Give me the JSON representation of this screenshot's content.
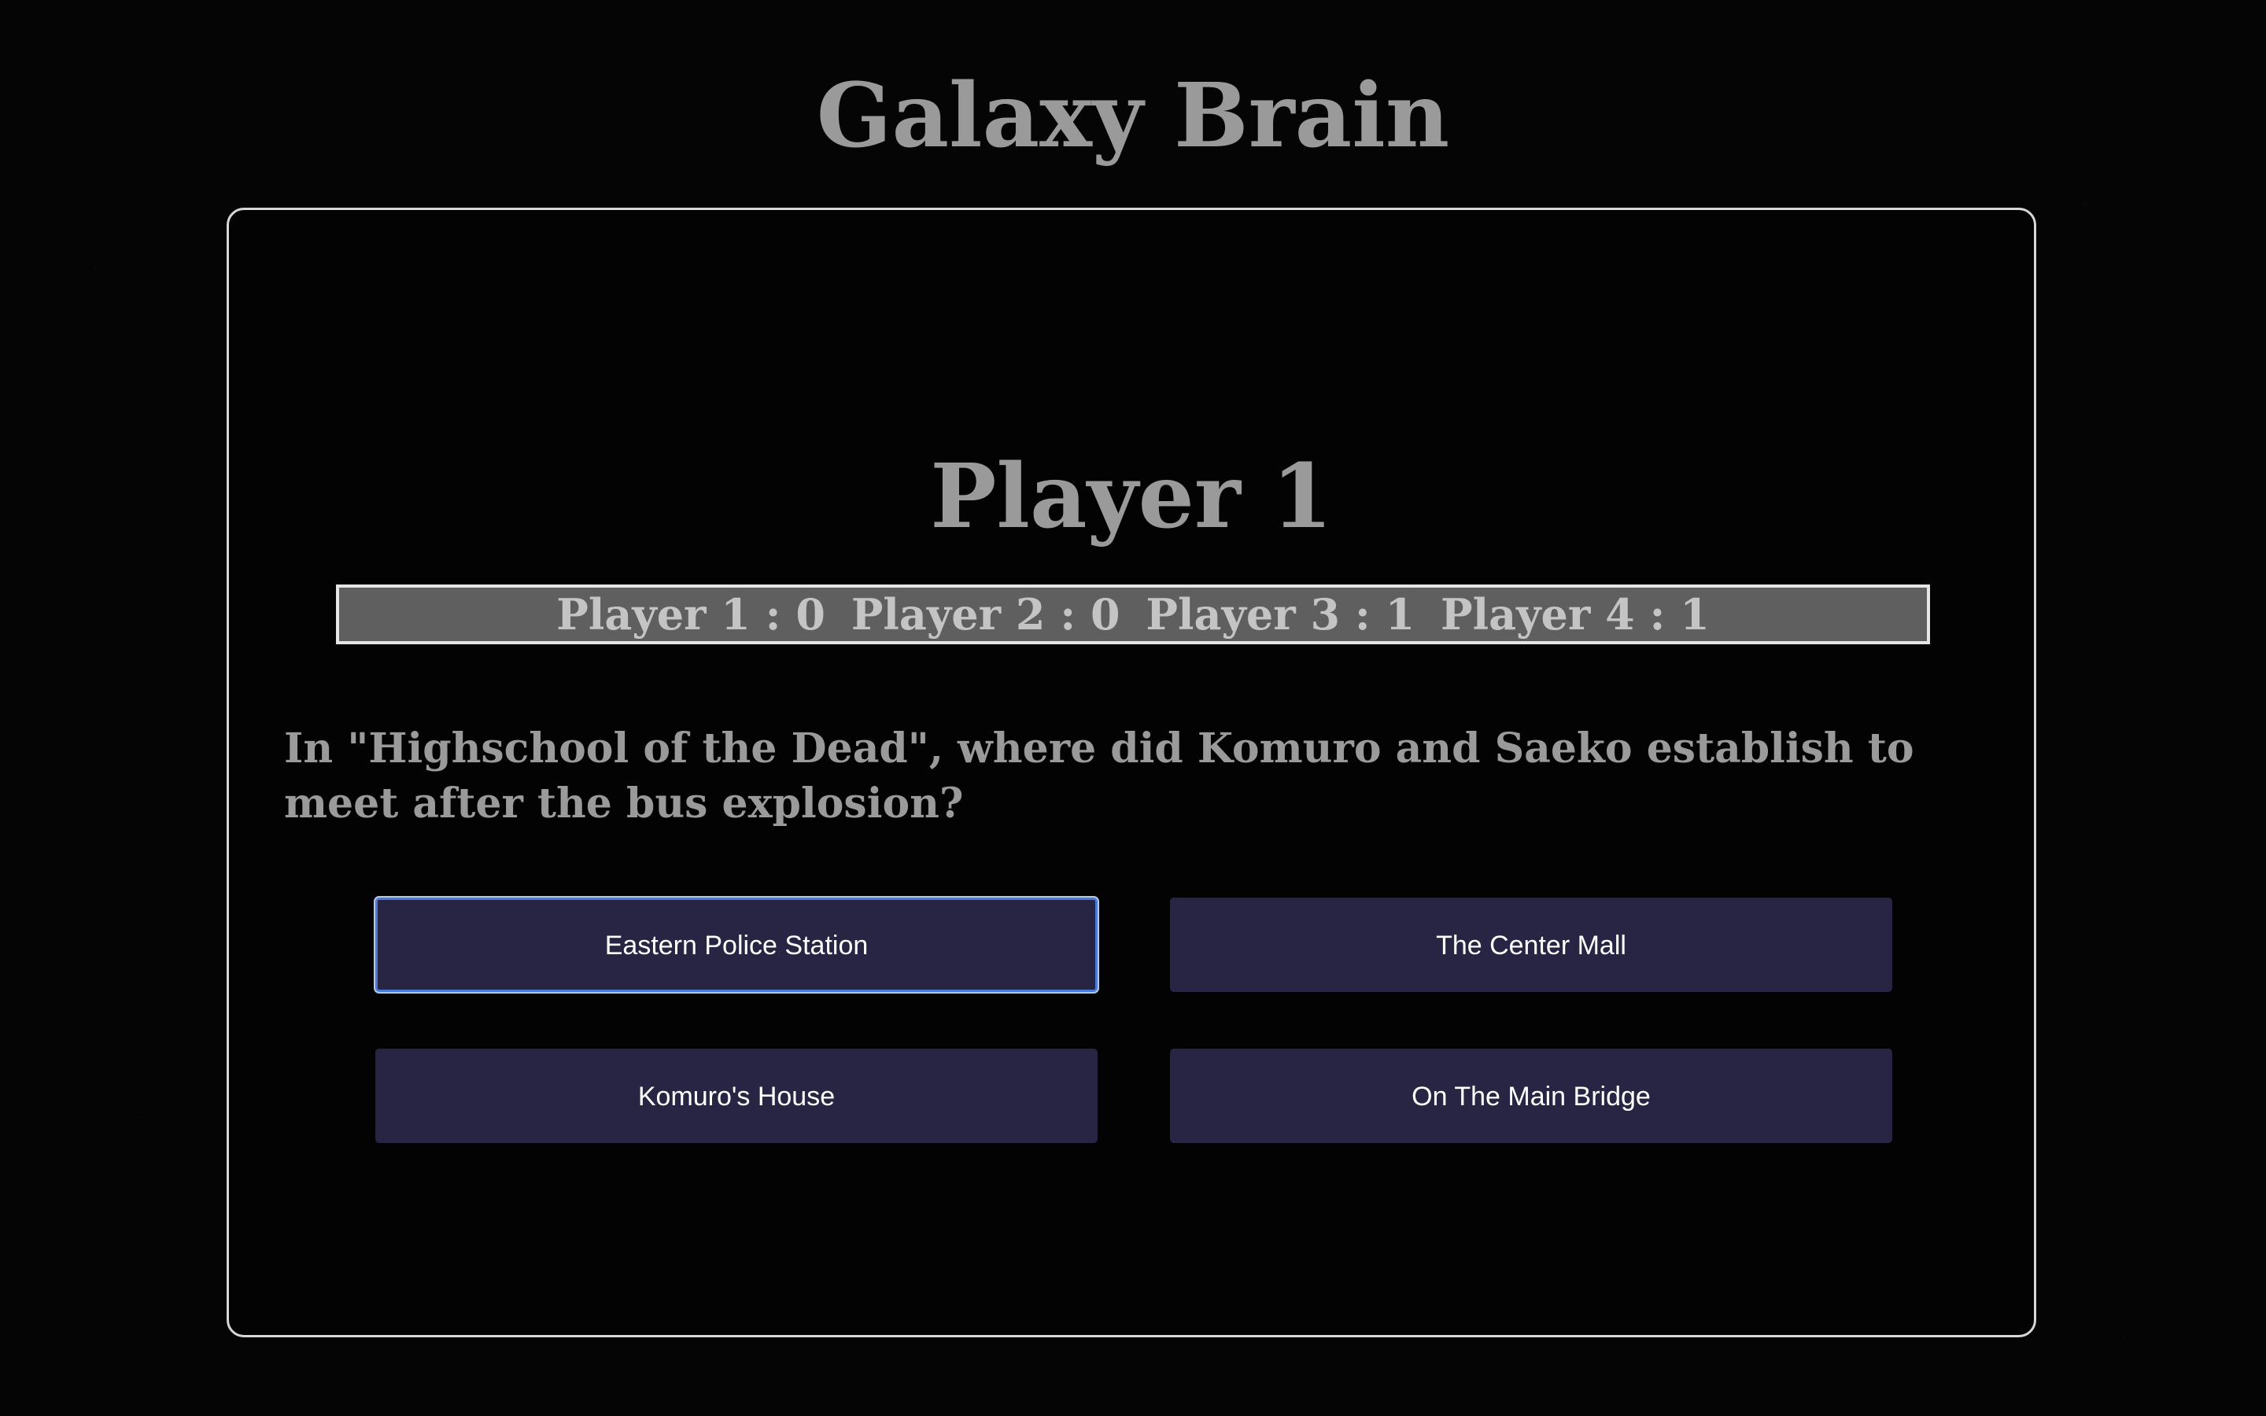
{
  "app": {
    "title": "Galaxy Brain"
  },
  "game": {
    "current_player": "Player 1",
    "scores": [
      {
        "label": "Player 1 : 0"
      },
      {
        "label": "Player 2 : 0"
      },
      {
        "label": "Player 3 : 1"
      },
      {
        "label": "Player 4 : 1"
      }
    ],
    "question": "In \"Highschool of the Dead\", where did Komuro and Saeko establish to meet after the bus explosion?",
    "answers": [
      {
        "label": "Eastern Police Station",
        "focused": true
      },
      {
        "label": "The Center Mall",
        "focused": false
      },
      {
        "label": "Komuro's House",
        "focused": false
      },
      {
        "label": "On The Main Bridge",
        "focused": false
      }
    ]
  },
  "colors": {
    "background": "#050505",
    "card_border": "#d7d7d7",
    "title_text": "#9a9a9a",
    "scoreboard_bg": "#5f5f5f",
    "answer_bg": "#282443",
    "focus_ring": "#4b7bd6"
  }
}
